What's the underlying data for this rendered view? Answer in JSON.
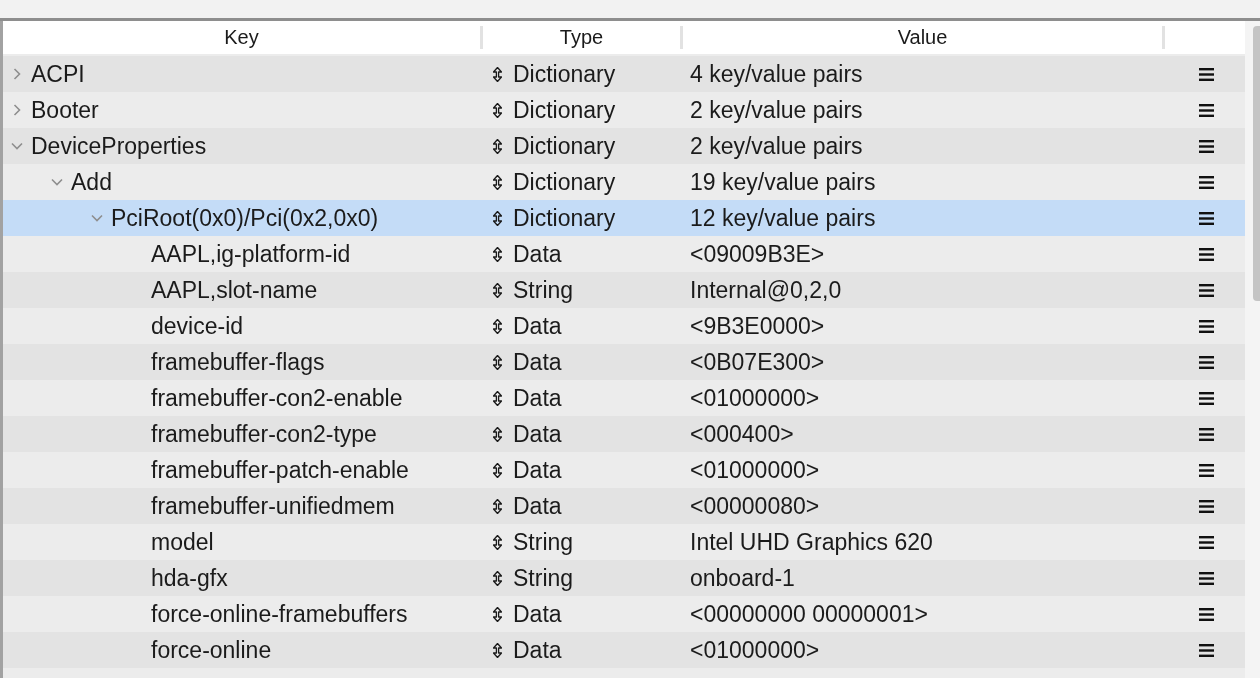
{
  "table": {
    "columns": [
      "Key",
      "Type",
      "Value"
    ],
    "rows": [
      {
        "key": "ACPI",
        "type": "Dictionary",
        "value": "4 key/value pairs",
        "expanded": false,
        "selected": false
      },
      {
        "key": "Booter",
        "type": "Dictionary",
        "value": "2 key/value pairs",
        "expanded": false,
        "selected": false
      },
      {
        "key": "DeviceProperties",
        "type": "Dictionary",
        "value": "2 key/value pairs",
        "expanded": true,
        "selected": false,
        "children": [
          {
            "key": "Add",
            "type": "Dictionary",
            "value": "19 key/value pairs",
            "expanded": true,
            "selected": false,
            "children": [
              {
                "key": "PciRoot(0x0)/Pci(0x2,0x0)",
                "type": "Dictionary",
                "value": "12 key/value pairs",
                "expanded": true,
                "selected": true,
                "children": [
                  {
                    "key": "AAPL,ig-platform-id",
                    "type": "Data",
                    "value": "<09009B3E>",
                    "selected": false
                  },
                  {
                    "key": "AAPL,slot-name",
                    "type": "String",
                    "value": "Internal@0,2,0",
                    "selected": false
                  },
                  {
                    "key": "device-id",
                    "type": "Data",
                    "value": "<9B3E0000>",
                    "selected": false
                  },
                  {
                    "key": "framebuffer-flags",
                    "type": "Data",
                    "value": "<0B07E300>",
                    "selected": false
                  },
                  {
                    "key": "framebuffer-con2-enable",
                    "type": "Data",
                    "value": "<01000000>",
                    "selected": false
                  },
                  {
                    "key": "framebuffer-con2-type",
                    "type": "Data",
                    "value": "<000400>",
                    "selected": false
                  },
                  {
                    "key": "framebuffer-patch-enable",
                    "type": "Data",
                    "value": "<01000000>",
                    "selected": false
                  },
                  {
                    "key": "framebuffer-unifiedmem",
                    "type": "Data",
                    "value": "<00000080>",
                    "selected": false
                  },
                  {
                    "key": "model",
                    "type": "String",
                    "value": "Intel UHD Graphics 620",
                    "selected": false
                  },
                  {
                    "key": "hda-gfx",
                    "type": "String",
                    "value": "onboard-1",
                    "selected": false
                  },
                  {
                    "key": "force-online-framebuffers",
                    "type": "Data",
                    "value": "<00000000 00000001>",
                    "selected": false
                  },
                  {
                    "key": "force-online",
                    "type": "Data",
                    "value": "<01000000>",
                    "selected": false
                  }
                ]
              }
            ]
          }
        ]
      }
    ]
  }
}
